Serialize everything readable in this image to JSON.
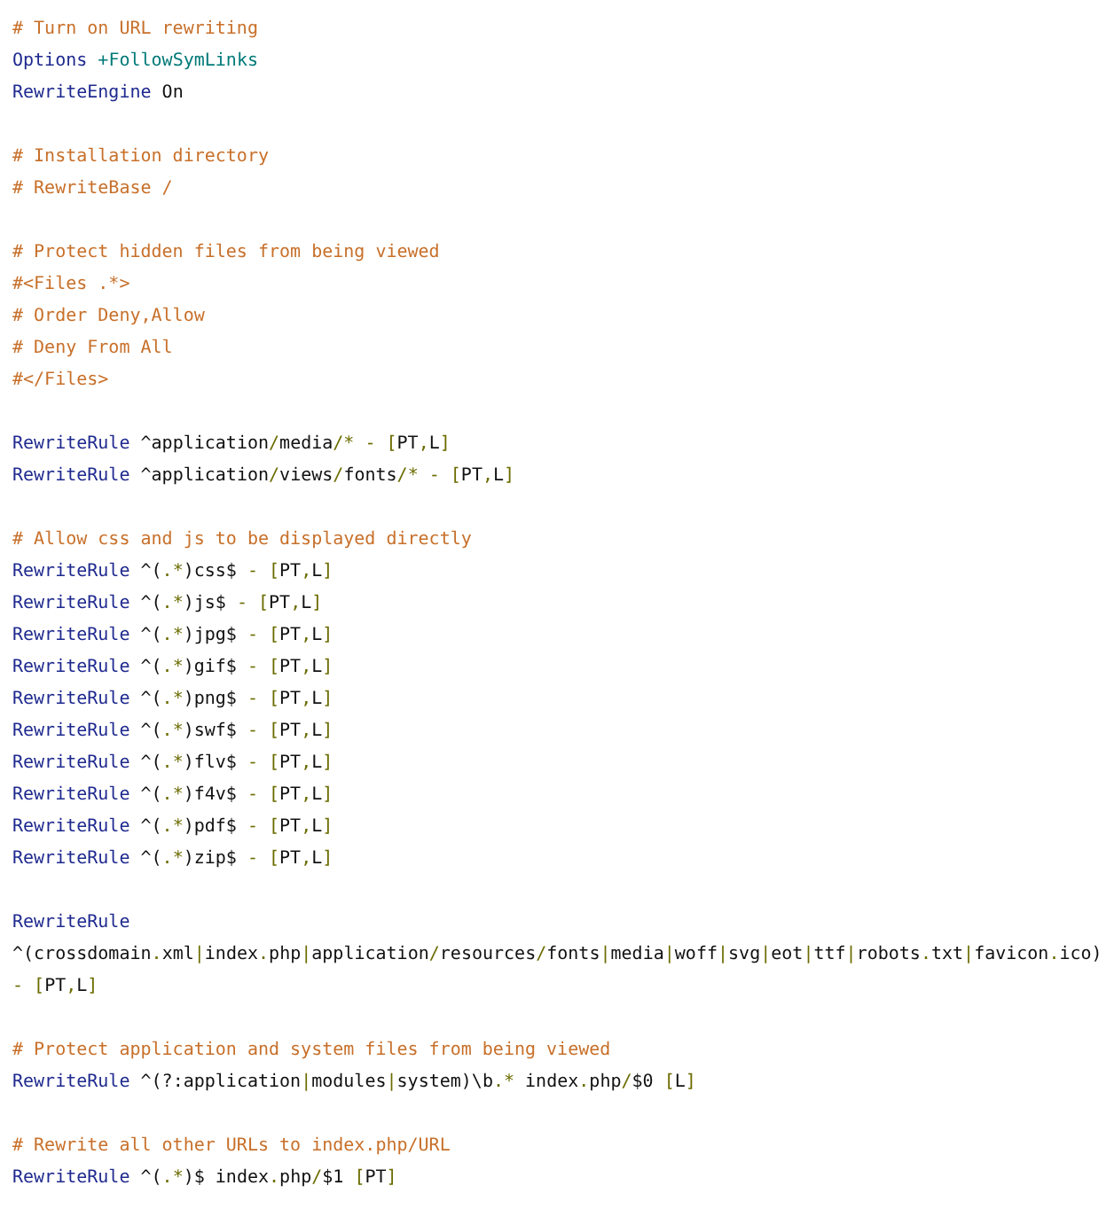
{
  "code_lines": [
    {
      "tokens": [
        {
          "kind": "comment",
          "text": "# Turn on URL rewriting"
        }
      ]
    },
    {
      "tokens": [
        {
          "kind": "keyword",
          "text": "Options "
        },
        {
          "kind": "flag",
          "text": "+FollowSymLinks"
        }
      ]
    },
    {
      "tokens": [
        {
          "kind": "keyword",
          "text": "RewriteEngine"
        },
        {
          "kind": "plain",
          "text": " On"
        }
      ]
    },
    {
      "gap_before": true,
      "tokens": [
        {
          "kind": "comment",
          "text": "# Installation directory"
        }
      ]
    },
    {
      "tokens": [
        {
          "kind": "comment",
          "text": "# RewriteBase /"
        }
      ]
    },
    {
      "gap_before": true,
      "tokens": [
        {
          "kind": "comment",
          "text": "# Protect hidden files from being viewed"
        }
      ]
    },
    {
      "tokens": [
        {
          "kind": "comment",
          "text": "#<Files .*>"
        }
      ]
    },
    {
      "tokens": [
        {
          "kind": "comment",
          "text": "# Order Deny,Allow"
        }
      ]
    },
    {
      "tokens": [
        {
          "kind": "comment",
          "text": "# Deny From All"
        }
      ]
    },
    {
      "tokens": [
        {
          "kind": "comment",
          "text": "#</Files>"
        }
      ]
    },
    {
      "gap_before": true,
      "tokens": [
        {
          "kind": "keyword",
          "text": "RewriteRule"
        },
        {
          "kind": "plain",
          "text": " ^application"
        },
        {
          "kind": "punct",
          "text": "/"
        },
        {
          "kind": "plain",
          "text": "media"
        },
        {
          "kind": "punct",
          "text": "/* - ["
        },
        {
          "kind": "plain",
          "text": "PT"
        },
        {
          "kind": "punct",
          "text": ","
        },
        {
          "kind": "plain",
          "text": "L"
        },
        {
          "kind": "punct",
          "text": "]"
        }
      ]
    },
    {
      "tokens": [
        {
          "kind": "keyword",
          "text": "RewriteRule"
        },
        {
          "kind": "plain",
          "text": " ^application"
        },
        {
          "kind": "punct",
          "text": "/"
        },
        {
          "kind": "plain",
          "text": "views"
        },
        {
          "kind": "punct",
          "text": "/"
        },
        {
          "kind": "plain",
          "text": "fonts"
        },
        {
          "kind": "punct",
          "text": "/* - ["
        },
        {
          "kind": "plain",
          "text": "PT"
        },
        {
          "kind": "punct",
          "text": ","
        },
        {
          "kind": "plain",
          "text": "L"
        },
        {
          "kind": "punct",
          "text": "]"
        }
      ]
    },
    {
      "gap_before": true,
      "tokens": [
        {
          "kind": "comment",
          "text": "# Allow css and js to be displayed directly"
        }
      ]
    },
    {
      "tokens": [
        {
          "kind": "keyword",
          "text": "RewriteRule"
        },
        {
          "kind": "plain",
          "text": " ^("
        },
        {
          "kind": "punct",
          "text": ".*"
        },
        {
          "kind": "plain",
          "text": ")css$ "
        },
        {
          "kind": "punct",
          "text": "- ["
        },
        {
          "kind": "plain",
          "text": "PT"
        },
        {
          "kind": "punct",
          "text": ","
        },
        {
          "kind": "plain",
          "text": "L"
        },
        {
          "kind": "punct",
          "text": "]"
        }
      ]
    },
    {
      "tokens": [
        {
          "kind": "keyword",
          "text": "RewriteRule"
        },
        {
          "kind": "plain",
          "text": " ^("
        },
        {
          "kind": "punct",
          "text": ".*"
        },
        {
          "kind": "plain",
          "text": ")js$ "
        },
        {
          "kind": "punct",
          "text": "- ["
        },
        {
          "kind": "plain",
          "text": "PT"
        },
        {
          "kind": "punct",
          "text": ","
        },
        {
          "kind": "plain",
          "text": "L"
        },
        {
          "kind": "punct",
          "text": "]"
        }
      ]
    },
    {
      "tokens": [
        {
          "kind": "keyword",
          "text": "RewriteRule"
        },
        {
          "kind": "plain",
          "text": " ^("
        },
        {
          "kind": "punct",
          "text": ".*"
        },
        {
          "kind": "plain",
          "text": ")jpg$ "
        },
        {
          "kind": "punct",
          "text": "- ["
        },
        {
          "kind": "plain",
          "text": "PT"
        },
        {
          "kind": "punct",
          "text": ","
        },
        {
          "kind": "plain",
          "text": "L"
        },
        {
          "kind": "punct",
          "text": "]"
        }
      ]
    },
    {
      "tokens": [
        {
          "kind": "keyword",
          "text": "RewriteRule"
        },
        {
          "kind": "plain",
          "text": " ^("
        },
        {
          "kind": "punct",
          "text": ".*"
        },
        {
          "kind": "plain",
          "text": ")gif$ "
        },
        {
          "kind": "punct",
          "text": "- ["
        },
        {
          "kind": "plain",
          "text": "PT"
        },
        {
          "kind": "punct",
          "text": ","
        },
        {
          "kind": "plain",
          "text": "L"
        },
        {
          "kind": "punct",
          "text": "]"
        }
      ]
    },
    {
      "tokens": [
        {
          "kind": "keyword",
          "text": "RewriteRule"
        },
        {
          "kind": "plain",
          "text": " ^("
        },
        {
          "kind": "punct",
          "text": ".*"
        },
        {
          "kind": "plain",
          "text": ")png$ "
        },
        {
          "kind": "punct",
          "text": "- ["
        },
        {
          "kind": "plain",
          "text": "PT"
        },
        {
          "kind": "punct",
          "text": ","
        },
        {
          "kind": "plain",
          "text": "L"
        },
        {
          "kind": "punct",
          "text": "]"
        }
      ]
    },
    {
      "tokens": [
        {
          "kind": "keyword",
          "text": "RewriteRule"
        },
        {
          "kind": "plain",
          "text": " ^("
        },
        {
          "kind": "punct",
          "text": ".*"
        },
        {
          "kind": "plain",
          "text": ")swf$ "
        },
        {
          "kind": "punct",
          "text": "- ["
        },
        {
          "kind": "plain",
          "text": "PT"
        },
        {
          "kind": "punct",
          "text": ","
        },
        {
          "kind": "plain",
          "text": "L"
        },
        {
          "kind": "punct",
          "text": "]"
        }
      ]
    },
    {
      "tokens": [
        {
          "kind": "keyword",
          "text": "RewriteRule"
        },
        {
          "kind": "plain",
          "text": " ^("
        },
        {
          "kind": "punct",
          "text": ".*"
        },
        {
          "kind": "plain",
          "text": ")flv$ "
        },
        {
          "kind": "punct",
          "text": "- ["
        },
        {
          "kind": "plain",
          "text": "PT"
        },
        {
          "kind": "punct",
          "text": ","
        },
        {
          "kind": "plain",
          "text": "L"
        },
        {
          "kind": "punct",
          "text": "]"
        }
      ]
    },
    {
      "tokens": [
        {
          "kind": "keyword",
          "text": "RewriteRule"
        },
        {
          "kind": "plain",
          "text": " ^("
        },
        {
          "kind": "punct",
          "text": ".*"
        },
        {
          "kind": "plain",
          "text": ")f4v$ "
        },
        {
          "kind": "punct",
          "text": "- ["
        },
        {
          "kind": "plain",
          "text": "PT"
        },
        {
          "kind": "punct",
          "text": ","
        },
        {
          "kind": "plain",
          "text": "L"
        },
        {
          "kind": "punct",
          "text": "]"
        }
      ]
    },
    {
      "tokens": [
        {
          "kind": "keyword",
          "text": "RewriteRule"
        },
        {
          "kind": "plain",
          "text": " ^("
        },
        {
          "kind": "punct",
          "text": ".*"
        },
        {
          "kind": "plain",
          "text": ")pdf$ "
        },
        {
          "kind": "punct",
          "text": "- ["
        },
        {
          "kind": "plain",
          "text": "PT"
        },
        {
          "kind": "punct",
          "text": ","
        },
        {
          "kind": "plain",
          "text": "L"
        },
        {
          "kind": "punct",
          "text": "]"
        }
      ]
    },
    {
      "tokens": [
        {
          "kind": "keyword",
          "text": "RewriteRule"
        },
        {
          "kind": "plain",
          "text": " ^("
        },
        {
          "kind": "punct",
          "text": ".*"
        },
        {
          "kind": "plain",
          "text": ")zip$ "
        },
        {
          "kind": "punct",
          "text": "- ["
        },
        {
          "kind": "plain",
          "text": "PT"
        },
        {
          "kind": "punct",
          "text": ","
        },
        {
          "kind": "plain",
          "text": "L"
        },
        {
          "kind": "punct",
          "text": "]"
        }
      ]
    },
    {
      "gap_before": true,
      "tokens": [
        {
          "kind": "keyword",
          "text": "RewriteRule"
        }
      ]
    },
    {
      "tokens": [
        {
          "kind": "plain",
          "text": "^(crossdomain"
        },
        {
          "kind": "punct",
          "text": "."
        },
        {
          "kind": "plain",
          "text": "xml"
        },
        {
          "kind": "punct",
          "text": "|"
        },
        {
          "kind": "plain",
          "text": "index"
        },
        {
          "kind": "punct",
          "text": "."
        },
        {
          "kind": "plain",
          "text": "php"
        },
        {
          "kind": "punct",
          "text": "|"
        },
        {
          "kind": "plain",
          "text": "application"
        },
        {
          "kind": "punct",
          "text": "/"
        },
        {
          "kind": "plain",
          "text": "resources"
        },
        {
          "kind": "punct",
          "text": "/"
        },
        {
          "kind": "plain",
          "text": "fonts"
        },
        {
          "kind": "punct",
          "text": "|"
        },
        {
          "kind": "plain",
          "text": "media"
        },
        {
          "kind": "punct",
          "text": "|"
        },
        {
          "kind": "plain",
          "text": "woff"
        },
        {
          "kind": "punct",
          "text": "|"
        },
        {
          "kind": "plain",
          "text": "svg"
        },
        {
          "kind": "punct",
          "text": "|"
        },
        {
          "kind": "plain",
          "text": "eot"
        },
        {
          "kind": "punct",
          "text": "|"
        },
        {
          "kind": "plain",
          "text": "ttf"
        },
        {
          "kind": "punct",
          "text": "|"
        },
        {
          "kind": "plain",
          "text": "robots"
        },
        {
          "kind": "punct",
          "text": "."
        },
        {
          "kind": "plain",
          "text": "txt"
        },
        {
          "kind": "punct",
          "text": "|"
        },
        {
          "kind": "plain",
          "text": "favicon"
        },
        {
          "kind": "punct",
          "text": "."
        },
        {
          "kind": "plain",
          "text": "ico)"
        }
      ]
    },
    {
      "tokens": [
        {
          "kind": "punct",
          "text": "- ["
        },
        {
          "kind": "plain",
          "text": "PT"
        },
        {
          "kind": "punct",
          "text": ","
        },
        {
          "kind": "plain",
          "text": "L"
        },
        {
          "kind": "punct",
          "text": "]"
        }
      ]
    },
    {
      "gap_before": true,
      "tokens": [
        {
          "kind": "comment",
          "text": "# Protect application and system files from being viewed"
        }
      ]
    },
    {
      "tokens": [
        {
          "kind": "keyword",
          "text": "RewriteRule"
        },
        {
          "kind": "plain",
          "text": " ^(?:application"
        },
        {
          "kind": "punct",
          "text": "|"
        },
        {
          "kind": "plain",
          "text": "modules"
        },
        {
          "kind": "punct",
          "text": "|"
        },
        {
          "kind": "plain",
          "text": "system)\\b"
        },
        {
          "kind": "punct",
          "text": ".*"
        },
        {
          "kind": "plain",
          "text": " index"
        },
        {
          "kind": "punct",
          "text": "."
        },
        {
          "kind": "plain",
          "text": "php"
        },
        {
          "kind": "punct",
          "text": "/"
        },
        {
          "kind": "plain",
          "text": "$0 "
        },
        {
          "kind": "punct",
          "text": "["
        },
        {
          "kind": "plain",
          "text": "L"
        },
        {
          "kind": "punct",
          "text": "]"
        }
      ]
    },
    {
      "gap_before": true,
      "tokens": [
        {
          "kind": "comment",
          "text": "# Rewrite all other URLs to index.php/URL"
        }
      ]
    },
    {
      "tokens": [
        {
          "kind": "keyword",
          "text": "RewriteRule"
        },
        {
          "kind": "plain",
          "text": " ^("
        },
        {
          "kind": "punct",
          "text": ".*"
        },
        {
          "kind": "plain",
          "text": ")$ index"
        },
        {
          "kind": "punct",
          "text": "."
        },
        {
          "kind": "plain",
          "text": "php"
        },
        {
          "kind": "punct",
          "text": "/"
        },
        {
          "kind": "plain",
          "text": "$1 "
        },
        {
          "kind": "punct",
          "text": "["
        },
        {
          "kind": "plain",
          "text": "PT"
        },
        {
          "kind": "punct",
          "text": "]"
        }
      ]
    }
  ]
}
